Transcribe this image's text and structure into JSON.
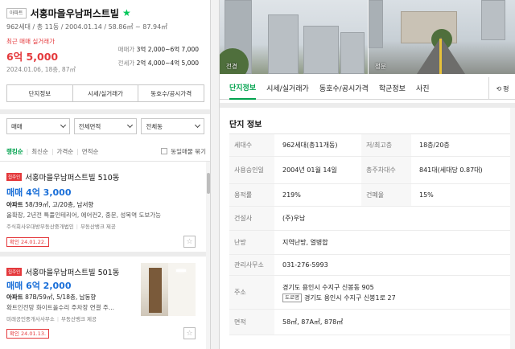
{
  "complex": {
    "type_tag": "아파트",
    "name": "서홍마을우남퍼스트빌",
    "info": "962세대 / 총 11동 / 2004.01.14 / 58.86㎡ ~ 87.94㎡",
    "recent_label": "최근 매매 실거래가",
    "recent_price": "6억 5,000",
    "recent_date": "2024.01.06, 18층, 87㎡",
    "sale_label": "매매가",
    "sale_range": "3억 2,000~6억 7,000",
    "jeonse_label": "전세가",
    "jeonse_range": "2억 4,000~4억 5,000"
  },
  "buttons": {
    "info": "단지정보",
    "market": "시세/실거래가",
    "unit": "동호수/공시가격"
  },
  "filters": {
    "deal": "매매",
    "area": "전체면적",
    "dong": "전체동"
  },
  "sort": {
    "items": [
      "랭킹순",
      "최신순",
      "가격순",
      "면적순"
    ],
    "same_label": "동일매물 묶기"
  },
  "listings": [
    {
      "badge": "집주인",
      "title": "서홍마을우남퍼스트빌 510동",
      "price": "매매 4억 3,000",
      "type": "아파트",
      "spec": "58/39㎡, 고/20층, 남서향",
      "desc": "올확장, 2년전 특풀인테리어, 에어컨2, 중문, 성복역 도보가능",
      "agent": "주식회사우대방부동산중개법인",
      "provider": "부동산뱅크 제공",
      "confirm": "확인 24.01.22."
    },
    {
      "badge": "집주인",
      "title": "서홍마을우남퍼스트빌 501동",
      "price": "매매 6억 2,000",
      "type": "아파트",
      "spec": "87B/59㎡, 5/18층, 남동향",
      "desc": "확트인전망 화이트올수리 주차장 연결 주...",
      "agent": "미래공인중개사사무소",
      "provider": "부동산뱅크 제공",
      "confirm": "확인 24.01.13."
    }
  ],
  "photos": {
    "label1": "전경",
    "label2": "정문"
  },
  "tabs": [
    "단지정보",
    "시세/실거래가",
    "동호수/공시가격",
    "학군정보",
    "사진"
  ],
  "tab_more": "평",
  "section_title": "단지 정보",
  "info_rows": {
    "households_k": "세대수",
    "households_v": "962세대(총11개동)",
    "floors_k": "저/최고층",
    "floors_v": "18층/20층",
    "approval_k": "사용승인일",
    "approval_v": "2004년 01월 14일",
    "parking_k": "총주차대수",
    "parking_v": "841대(세대당 0.87대)",
    "far_k": "용적률",
    "far_v": "219%",
    "bcr_k": "건폐율",
    "bcr_v": "15%",
    "builder_k": "건설사",
    "builder_v": "(주)우남",
    "heating_k": "난방",
    "heating_v": "지역난방, 열병합",
    "office_k": "관리사무소",
    "office_v": "031-276-5993",
    "address_k": "주소",
    "address_v": "경기도 용인시 수지구 신봉동 905",
    "road_tag": "도로명",
    "road_addr": "경기도 용인시 수지구 신봉1로 27",
    "area_k": "면적",
    "area_v": "58㎡, 87A㎡, 878㎡"
  },
  "colors": {
    "accent_green": "#03c75a",
    "price_red": "#e4393c",
    "price_blue": "#1a6fd8"
  }
}
